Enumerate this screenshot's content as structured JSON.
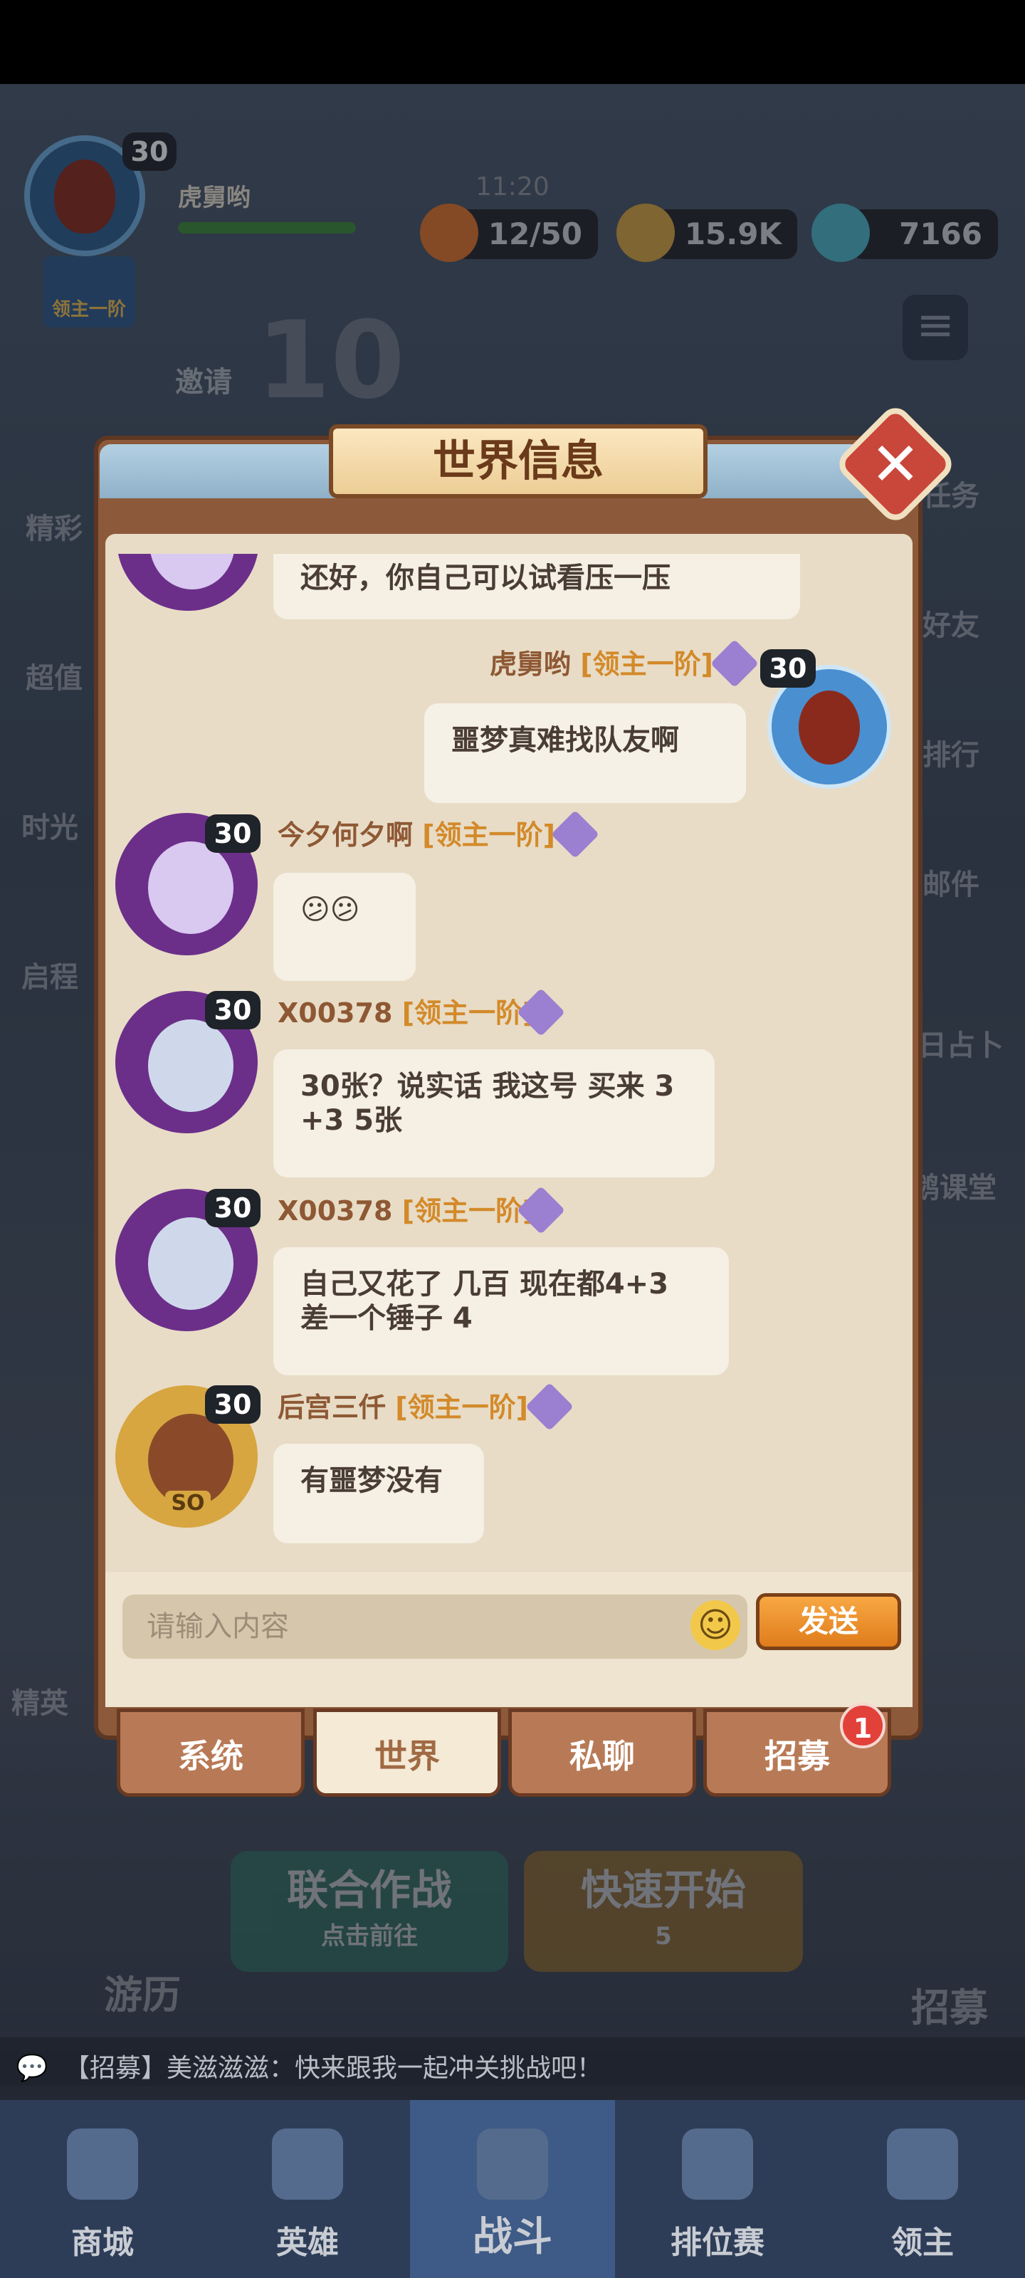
{
  "hud": {
    "player_name": "虎舅哟",
    "level": "30",
    "rank_badge": "领主一阶",
    "time": "11:20",
    "stamina": "12/50",
    "gold": "15.9K",
    "gems": "7166",
    "invite": "邀请",
    "round": "10",
    "side_left": [
      "精彩",
      "超值",
      "时光",
      "启程"
    ],
    "side_right": [
      "任务",
      "好友",
      "排行",
      "邮件",
      "日占卜",
      "鹅课堂"
    ],
    "elite": "精英"
  },
  "dialog": {
    "title": "世界信息",
    "close_icon": "close-icon",
    "messages": [
      {
        "type": "other-partial",
        "text": "还好，你自己可以试看压一压"
      },
      {
        "type": "self",
        "name": "虎舅哟",
        "rank": "[领主一阶]",
        "level": "30",
        "text": "噩梦真难找队友啊"
      },
      {
        "type": "other",
        "name": "今夕何夕啊",
        "rank": "[领主一阶]",
        "level": "30",
        "text": "😕😕"
      },
      {
        "type": "other",
        "name": "X00378",
        "rank": "[领主一阶]",
        "level": "30",
        "text": "30张？说实话  我这号 买来 3 +3   5张"
      },
      {
        "type": "other",
        "name": "X00378",
        "rank": "[领主一阶]",
        "level": "30",
        "text": "自己又花了 几百  现在都4+3 差一个锤子 4"
      },
      {
        "type": "other",
        "name": "后宫三仟",
        "rank": "[领主一阶]",
        "level": "30",
        "avatar_badge": "SO",
        "text": "有噩梦没有"
      }
    ],
    "input_placeholder": "请输入内容",
    "send_label": "发送",
    "tabs": [
      "系统",
      "世界",
      "私聊",
      "招募"
    ],
    "active_tab": "世界",
    "recruit_badge": "1"
  },
  "background": {
    "joint_battle": "联合作战",
    "joint_battle_sub": "点击前往",
    "quick_start": "快速开始",
    "quick_start_cost": "5",
    "travel": "游历",
    "recruit": "招募"
  },
  "ticker": "【招募】美滋滋滋：快来跟我一起冲关挑战吧！",
  "nav": [
    "商城",
    "英雄",
    "战斗",
    "排位赛",
    "领主"
  ],
  "active_nav": "战斗",
  "colors": {
    "accent_orange": "#e07c1c",
    "frame_brown": "#8c5a3a",
    "panel_cream": "#e8dcc6",
    "badge_red": "#e2413a"
  }
}
